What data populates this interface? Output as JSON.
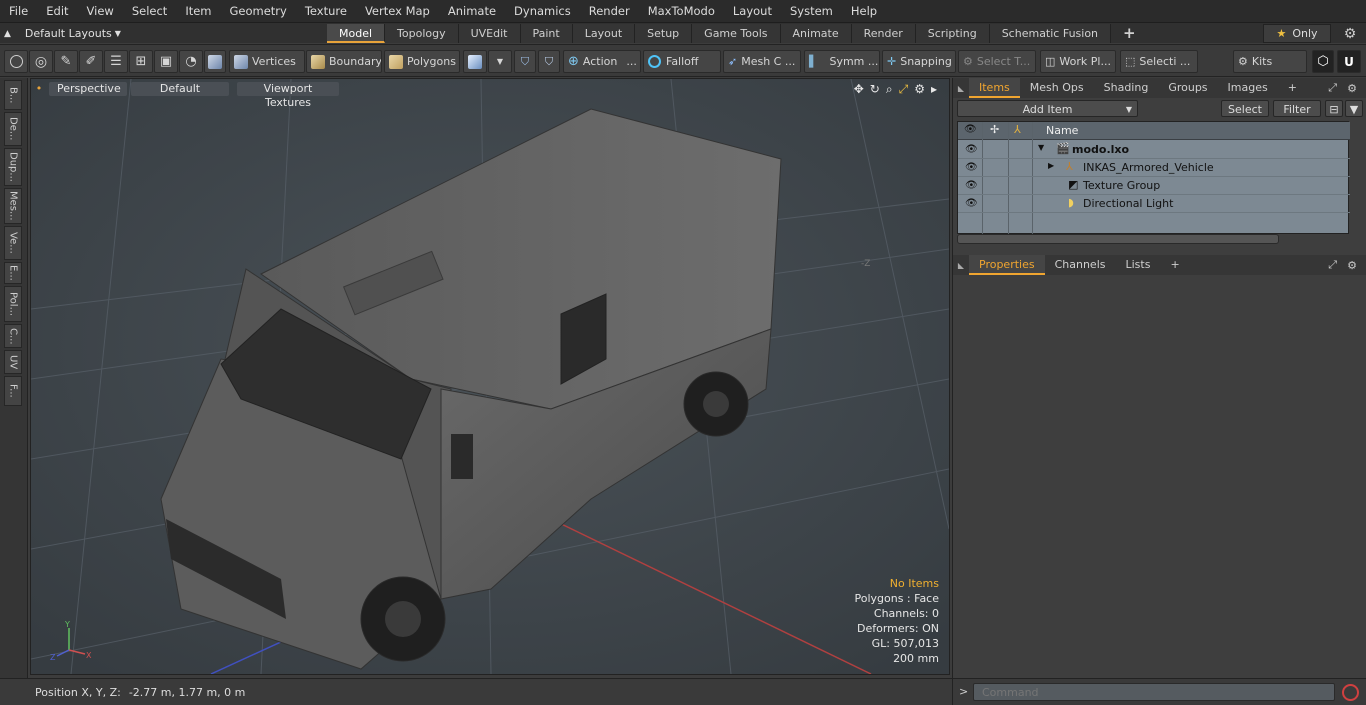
{
  "menu": [
    "File",
    "Edit",
    "View",
    "Select",
    "Item",
    "Geometry",
    "Texture",
    "Vertex Map",
    "Animate",
    "Dynamics",
    "Render",
    "MaxToModo",
    "Layout",
    "System",
    "Help"
  ],
  "layouts_label": "Default Layouts",
  "layout_tabs": [
    "Model",
    "Topology",
    "UVEdit",
    "Paint",
    "Layout",
    "Setup",
    "Game Tools",
    "Animate",
    "Render",
    "Scripting",
    "Schematic Fusion"
  ],
  "layout_tab_active": "Model",
  "only_label": "Only",
  "toolbar": {
    "vertices": "Vertices",
    "boundary": "Boundary",
    "polygons": "Polygons",
    "action": "Action",
    "falloff": "Falloff",
    "mesh": "Mesh C ...",
    "symm": "Symm ...",
    "snapping": "Snapping",
    "select_t": "Select T...",
    "work_pl": "Work Pl...",
    "selecti": "Selecti ...",
    "kits": "Kits"
  },
  "left_tabs": [
    "B...",
    "De...",
    "Dup...",
    "Mes...",
    "Ve...",
    "E...",
    "Pol...",
    "C...",
    "UV",
    "F..."
  ],
  "viewport": {
    "perspective": "Perspective",
    "default": "Default",
    "textures": "Viewport Textures",
    "axis_z": "-Z",
    "stats": {
      "no_items": "No Items",
      "polygons": "Polygons : Face",
      "channels": "Channels: 0",
      "deformers": "Deformers: ON",
      "gl": "GL: 507,013",
      "scale": "200 mm"
    }
  },
  "status": {
    "label": "Position X, Y, Z:",
    "value": "-2.77 m, 1.77 m, 0 m"
  },
  "items_panel": {
    "tabs": [
      "Items",
      "Mesh Ops",
      "Shading",
      "Groups",
      "Images"
    ],
    "active_tab": "Items",
    "add_item": "Add Item",
    "select": "Select",
    "filter": "Filter",
    "col_name": "Name",
    "rows": [
      {
        "name": "modo.lxo",
        "indent": 0,
        "bold": true
      },
      {
        "name": "INKAS_Armored_Vehicle",
        "indent": 1,
        "bold": false
      },
      {
        "name": "Texture Group",
        "indent": 1,
        "bold": false
      },
      {
        "name": "Directional Light",
        "indent": 1,
        "bold": false
      }
    ]
  },
  "props_panel": {
    "tabs": [
      "Properties",
      "Channels",
      "Lists"
    ],
    "active_tab": "Properties"
  },
  "command": {
    "prompt": ">",
    "placeholder": "Command"
  },
  "colors": {
    "accent": "#f0a530",
    "viewport_bg": "#42484e",
    "list_bg": "#7d8993"
  }
}
